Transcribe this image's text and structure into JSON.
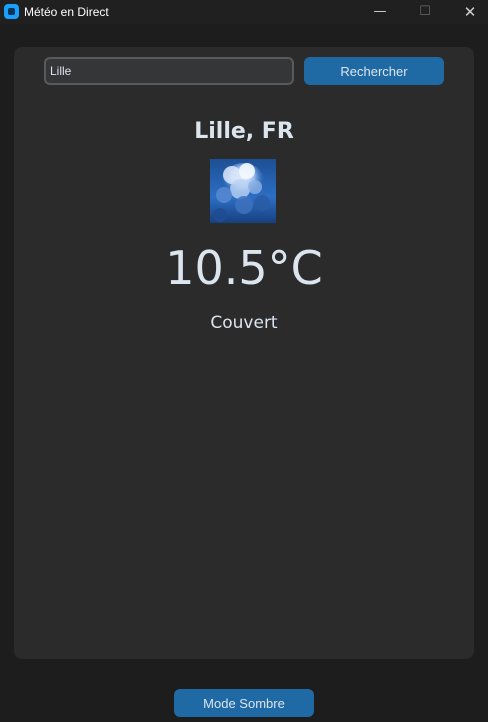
{
  "window": {
    "title": "Météo en Direct",
    "icon": "app-icon",
    "controls": {
      "minimize": "—",
      "maximize": "☐",
      "close": "✕"
    }
  },
  "search": {
    "value": "Lille",
    "button_label": "Rechercher"
  },
  "weather": {
    "city": "Lille, FR",
    "icon": "overcast-clouds-icon",
    "temperature": "10.5°C",
    "description": "Couvert"
  },
  "footer": {
    "mode_button_label": "Mode Sombre"
  },
  "colors": {
    "accent": "#1f6aa5",
    "panel": "#2b2b2b",
    "background": "#1d1d1d",
    "text": "#dce4ee"
  }
}
